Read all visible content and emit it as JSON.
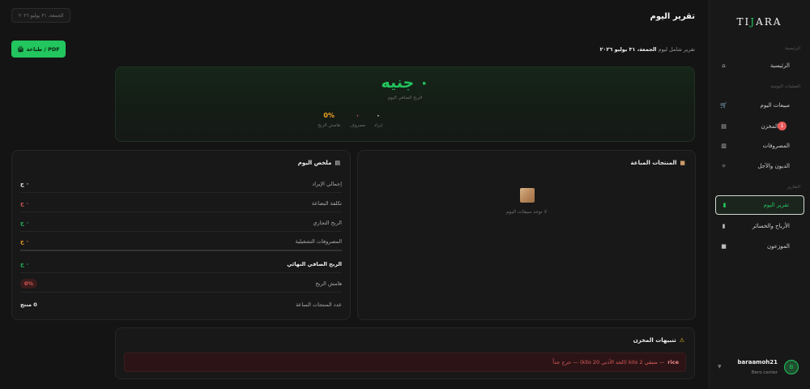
{
  "sidebar": {
    "logo_left": "TI",
    "logo_mark": "J",
    "logo_right": "ARA",
    "sections": {
      "main": "الرئيسية",
      "ops": "العمليات اليومية",
      "reports": "التقارير"
    },
    "items": [
      {
        "label": "الرئيسية",
        "icon": "home-icon"
      },
      {
        "label": "مبيعات اليوم",
        "icon": "cart-icon"
      },
      {
        "label": "المخزن",
        "icon": "box-icon",
        "badge": "1"
      },
      {
        "label": "المصروفات",
        "icon": "receipt-icon"
      },
      {
        "label": "الديون والآجل",
        "icon": "handshake-icon"
      },
      {
        "label": "تقرير اليوم",
        "icon": "chart-icon",
        "active": true
      },
      {
        "label": "الأرباح والخسائر",
        "icon": "chart-icon"
      },
      {
        "label": "الموزعون",
        "icon": "truck-icon"
      }
    ],
    "user": {
      "name": "baraamoh21",
      "role": "Bero center",
      "initial": "B"
    }
  },
  "header": {
    "title": "تقرير اليوم",
    "date_pill": "الجمعة، ٣١ يوليو ٢٠٢٦",
    "subtitle_prefix": "تقرير شامل ليوم",
    "subtitle_date": "الجمعة، ٣١ يوليو ٢٠٢٦",
    "print_label": "طباعة / PDF"
  },
  "hero": {
    "value": "٠ جنيه",
    "label": "الربح الصافي اليوم",
    "stats": [
      {
        "value": "٠",
        "label": "إيراد",
        "color": "#e8e8e8"
      },
      {
        "value": "٠",
        "label": "مصروف",
        "color": "#e05a5a"
      },
      {
        "value": "0%",
        "label": "هامش الربح",
        "color": "#f5a524"
      }
    ]
  },
  "summary": {
    "title": "ملخص اليوم",
    "rows": [
      {
        "label": "إجمالي الإيراد",
        "value": "٠ ج",
        "color": "#f0f0f0"
      },
      {
        "label": "تكلفة البضاعة",
        "value": "٠ ج",
        "color": "#e05a5a"
      },
      {
        "label": "الربح التجاري",
        "value": "٠ ج",
        "color": "#22c55e"
      },
      {
        "label": "المصروفات التشغيلية",
        "value": "٠ ج",
        "color": "#f5a524"
      },
      {
        "label": "الربح الصافي النهائي",
        "value": "٠ ج",
        "color": "#22c55e"
      },
      {
        "label": "هامش الربح",
        "value": "0%"
      },
      {
        "label": "عدد المنتجات المباعة",
        "value": "0 منتج",
        "color": "#f0f0f0"
      }
    ]
  },
  "products": {
    "title": "المنتجات المباعة",
    "empty_text": "لا توجد مبيعات اليوم"
  },
  "alerts": {
    "title": "تنبيهات المخزن",
    "items": [
      {
        "name": "rice",
        "text": "— متبقي 2 kilo (الحد الأدنى 20 kilo) — حرج جداً"
      }
    ]
  }
}
